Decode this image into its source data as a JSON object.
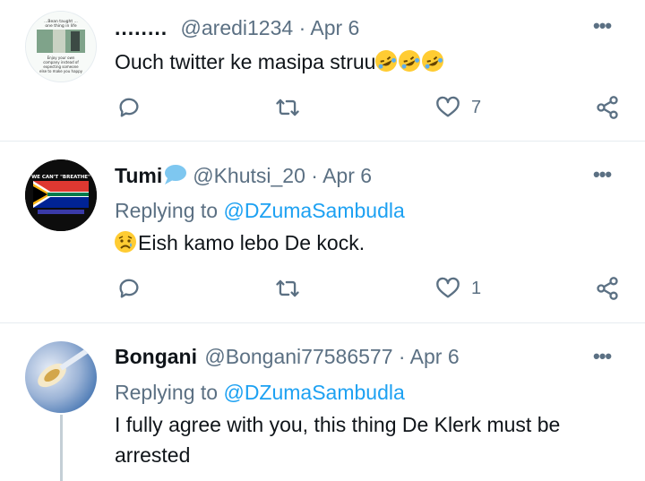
{
  "tweets": [
    {
      "name": "........",
      "handle": "@aredi1234",
      "sep": " · ",
      "date": "Apr 6",
      "text": "Ouch twitter ke masipa struu",
      "emoji": "rolling-on-floor-laughing x3",
      "likes": "7",
      "avatar_text": [
        "...Bean taught ...",
        "one thing in life",
        "Enjoy your own",
        "company instead of",
        "expecting someone",
        "else to make you happy"
      ]
    },
    {
      "name": "Tumi",
      "badge": "speech-bubble-icon",
      "handle": "@Khutsi_20",
      "sep": " · ",
      "date": "Apr 6",
      "replying_prefix": "Replying to ",
      "replying_to": "@DZumaSambudla",
      "text": "Eish kamo lebo De kock.",
      "emoji": "sad-but-relieved-face",
      "likes": "1",
      "avatar_text": [
        "WE CAN'T \"BREATHE\""
      ]
    },
    {
      "name": "Bongani",
      "handle": "@Bongani77586577",
      "sep": " · ",
      "date": "Apr 6",
      "replying_prefix": "Replying to ",
      "replying_to": "@DZumaSambudla",
      "text": "I fully agree with you, this thing De Klerk must be arrested"
    }
  ],
  "icons": {
    "reply": "reply-icon",
    "retweet": "retweet-icon",
    "like": "heart-icon",
    "share": "share-icon",
    "more": "more-icon"
  },
  "colors": {
    "secondary_text": "#5b7083",
    "link": "#1da1f2",
    "divider": "#e6ecf0"
  }
}
